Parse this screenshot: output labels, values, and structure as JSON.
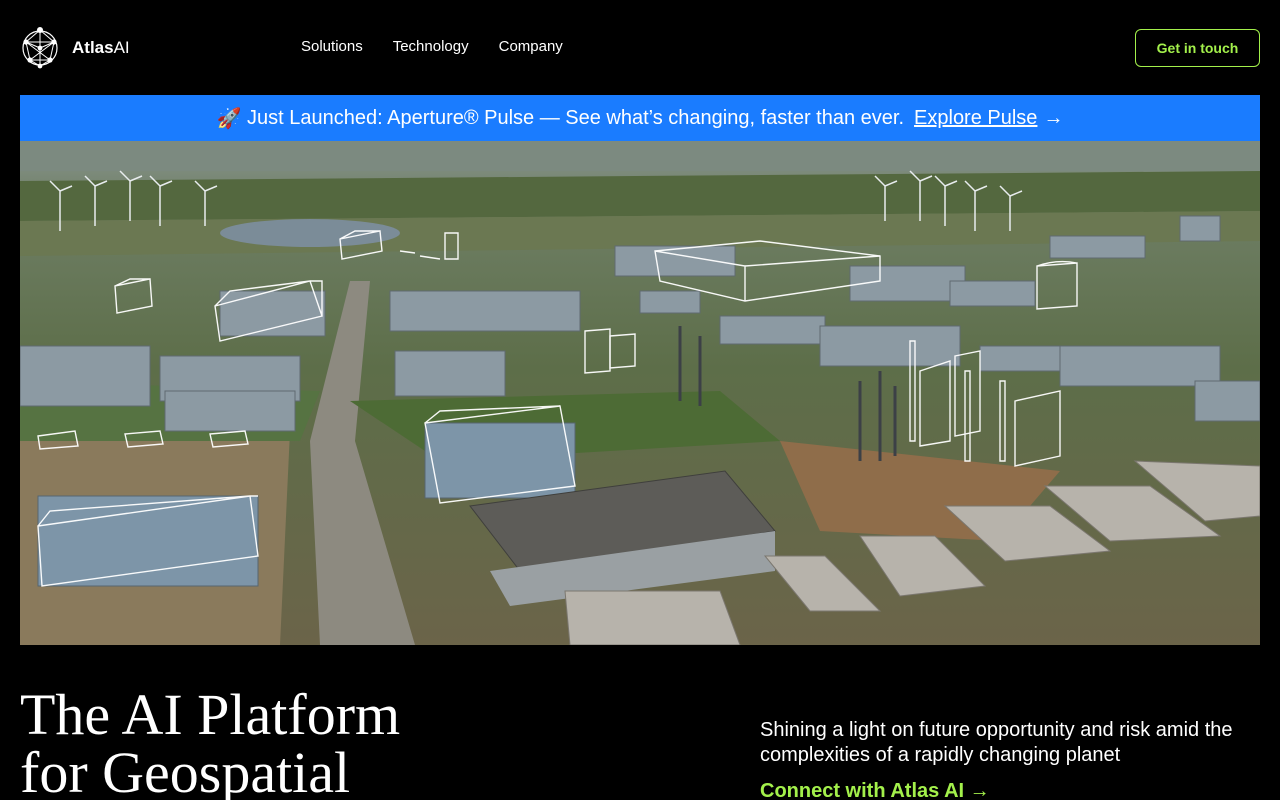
{
  "header": {
    "brand_bold": "Atlas",
    "brand_rest": "AI",
    "nav": [
      {
        "label": "Solutions"
      },
      {
        "label": "Technology"
      },
      {
        "label": "Company"
      }
    ],
    "cta_label": "Get in touch",
    "accent_color": "#a3f04b"
  },
  "banner": {
    "emoji": "🚀",
    "text": "Just Launched: Aperture® Pulse — See what’s changing, faster than ever.",
    "link_label": "Explore Pulse",
    "arrow": "→",
    "background": "#1a7cff"
  },
  "hero": {
    "icon": "industrial-park-aerial-photo"
  },
  "main": {
    "headline_line1": "The AI Platform",
    "headline_line2": "for Geospatial",
    "tagline": "Shining a light on future opportunity and risk amid the complexities of a rapidly changing planet",
    "connect_label": "Connect with Atlas AI →"
  }
}
